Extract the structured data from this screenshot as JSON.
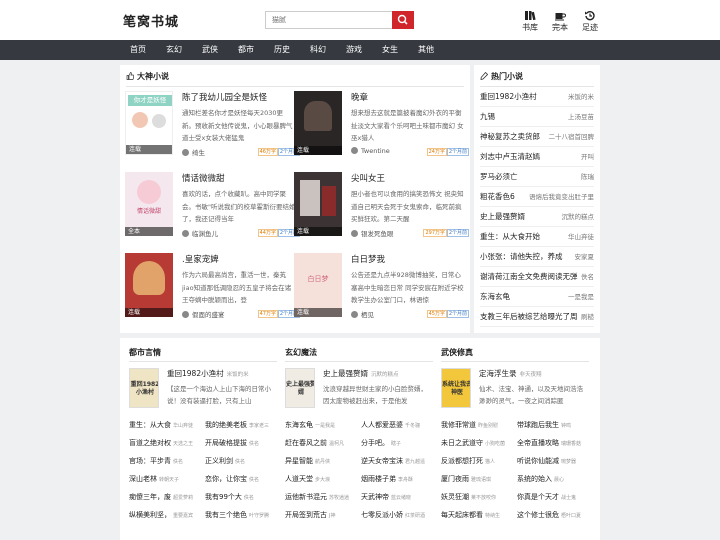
{
  "header": {
    "logo": "笔窝书城",
    "search_placeholder": "猫腻",
    "icons": [
      {
        "name": "bookshelf-icon",
        "label": "书库"
      },
      {
        "name": "coffee-cup-icon",
        "label": "完本"
      },
      {
        "name": "history-icon",
        "label": "足迹"
      }
    ]
  },
  "nav": [
    "首页",
    "玄幻",
    "武侠",
    "都市",
    "历史",
    "科幻",
    "游戏",
    "女生",
    "其他"
  ],
  "god": {
    "title": "大神小说",
    "books": [
      {
        "title": "陈了我幼儿园全是妖怪",
        "cover_text": "你才是妖怪",
        "cover_tag": "连载",
        "desc": "通知栏差名你才是妖怪每天2030更新。预收新文他传说鬼，小心眼暴脾气道士受x女装大佬猛鬼",
        "author": "绮生",
        "words": "46万字",
        "updated": "2个月前",
        "color": "#ffffff"
      },
      {
        "title": "晚章",
        "cover_text": "",
        "cover_tag": "连载",
        "desc": "想来想去这就是篇披着魔幻外衣的平衡扯淡文大家看个乐呵吧土味都市魔幻 女巫x猎人",
        "author": "Twentine",
        "words": "24万字",
        "updated": "2个月前",
        "color": "#2a2626"
      },
      {
        "title": "情话微微甜",
        "cover_text": "情话微甜",
        "cover_tag": "全本",
        "desc": "喜欢的话，点个收藏叭。高中同学聚会。书敏\"听说我们的校草霍斯衍要结婚了，我还记得当年",
        "author": "临渊鱼儿",
        "words": "44万字",
        "updated": "2个月前",
        "color": "#f4e8ee"
      },
      {
        "title": "尖叫女王",
        "cover_text": "",
        "cover_tag": "连载",
        "desc": "胆小者也可以食用的搞笑恐怖文 祝央知道自己明天会死于女鬼索命，临死前疯买鲜狂欢。第二天醒",
        "author": "银发死鱼眼",
        "words": "297万字",
        "updated": "2个月前",
        "color": "#3b3334"
      },
      {
        "title": ".皇家宠婢",
        "cover_text": "",
        "cover_tag": "连载",
        "desc": "作为六局最高尚宫，重活一世，秦芄jiao知道那低调隐忍的五皇子将会在诸王夺嫡中脱颖而出，登",
        "author": "假面的盛宴",
        "words": "47万字",
        "updated": "2个月前",
        "color": "#b73a35"
      },
      {
        "title": "白日梦我",
        "cover_text": "白日梦",
        "cover_tag": "连载",
        "desc": "公告还是九点半928微博抽奖，日常心塞高中生暗恋日常 同学安宸在附近学校教学生办公室门口，林语惊",
        "author": "栖见",
        "words": "45万字",
        "updated": "2个月前",
        "color": "#f5e1da"
      }
    ]
  },
  "hot": {
    "title": "热门小说",
    "items": [
      {
        "name": "重回1982小渔村",
        "author": "米饭的米"
      },
      {
        "name": "九锡",
        "author": "上汤豆苗"
      },
      {
        "name": "神秘复苏之卖货郎",
        "author": "二十八宿首回脾"
      },
      {
        "name": "刘志中卢玉清赵嫣",
        "author": "开叫"
      },
      {
        "name": "罗马必须亡",
        "author": "陈瑞"
      },
      {
        "name": "粗花香色6",
        "author": "语熔后我竟变出肚子里"
      },
      {
        "name": "史上最强赘婿",
        "author": "沉默的糕点"
      },
      {
        "name": "重生：从大食开始",
        "author": "华山弃徒"
      },
      {
        "name": "小张张：请他失控，养成",
        "author": "安家夏"
      },
      {
        "name": "谢清荷江南全文免费阅读无弹",
        "author": "佚名"
      },
      {
        "name": "东海玄龟",
        "author": "一是我是"
      },
      {
        "name": "支教三年后被综艺给曝光了周",
        "author": "刷糙"
      }
    ]
  },
  "columns": [
    {
      "title": "都市言情",
      "feature": {
        "title": "重回1982小渔村",
        "author": "米饭的米",
        "desc": "【这是一个海边人上山下海的日常小说！没有装逼打脸，只有上山",
        "cover_text": "重回1982小渔村",
        "color": "#efe4c3"
      },
      "rows": [
        [
          "重生：从大食",
          "华山弃徒",
          "我的绝美老板",
          "李家老三"
        ],
        [
          "盲道之绝对权",
          "天选之王",
          "开局破格提拔",
          "佚名"
        ],
        [
          "官场：平步青",
          "佚名",
          "正义利剑",
          "佚名"
        ],
        [
          "深山老林",
          "转朝天子",
          "恋你，让你宝",
          "佚名"
        ],
        [
          "痴傻三年，废",
          "超爱萝莉",
          "我有99个大",
          "佚名"
        ],
        [
          "纵横美利坚，",
          "重要嘉宾",
          "我有三个绝色",
          "叶守罗腾"
        ]
      ]
    },
    {
      "title": "玄幻魔法",
      "feature": {
        "title": "史上最强赘婿",
        "author": "沉默的糕点",
        "desc": "沈浪穿越异世财主家的小白脸赘婿，因太废物被赶出来，于是他发",
        "cover_text": "史上最强赘婿",
        "color": "#f0ece4"
      },
      "rows": [
        [
          "东海玄龟",
          "一是我是",
          "人人都爱恶婆",
          "千冬骊"
        ],
        [
          "赶在春风之前",
          "温柯凡",
          "分手吧。",
          "瞎子"
        ],
        [
          "异星智能",
          "航丹侠",
          "逆天女帝宝沫",
          "君九越遥"
        ],
        [
          "人道天堂",
          "步大浪",
          "烟雨楼子弟",
          "李舟酥"
        ],
        [
          "运他新书混元",
          "苏牧逍逍",
          "天武神帝",
          "蓝云绪晓"
        ],
        [
          "开局签到荒古",
          "J神",
          "七零反派小娇",
          "红茶研酒"
        ]
      ]
    },
    {
      "title": "武侠修真",
      "feature": {
        "title": "定海浮生录",
        "author": "非天夜翔",
        "desc": "仙术、法宝、神通，以及天地间浩浩渺渺的灵气，一夜之间消踪匿",
        "cover_text": "系统让我去神医",
        "color": "#f3c73b"
      },
      "rows": [
        [
          "我修菲常道",
          "昨鱼别慰",
          "带球跑后我生",
          "钟鸣"
        ],
        [
          "未日之武道守",
          "小狗吃菌",
          "全帝直播攻略",
          "瑞珊香菇"
        ],
        [
          "反派都想打死",
          "猫人",
          "听说你仙能减",
          "琬梦器"
        ],
        [
          "厦门夜雨",
          "雅琉语琪",
          "系统的始入",
          "晨心"
        ],
        [
          "妖灵狂潮",
          "莱不放咬你",
          "你真是个天才",
          "战士鬼"
        ],
        [
          "每天起床都看",
          "特纳生",
          "这个修士很危",
          "梧叶口夏"
        ]
      ]
    }
  ]
}
